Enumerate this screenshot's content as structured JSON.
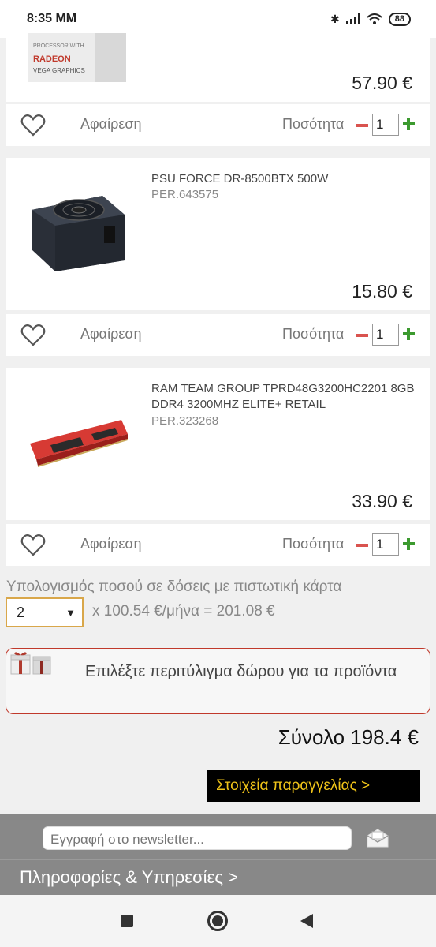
{
  "status_bar": {
    "time": "8:35 MM",
    "battery": "88"
  },
  "cart": {
    "items": [
      {
        "price": "57.90 €",
        "qty": "1"
      },
      {
        "name": "PSU FORCE DR-8500BTX 500W",
        "code": "PER.643575",
        "price": "15.80 €",
        "qty": "1"
      },
      {
        "name": "RAM TEAM GROUP TPRD48G3200HC2201 8GB DDR4 3200MHZ ELITE+ RETAIL",
        "code": "PER.323268",
        "price": "33.90 €",
        "qty": "1"
      }
    ],
    "item_image_text": [
      "PROCESSOR WITH",
      "RADEON",
      "VEGA GRAPHICS"
    ],
    "remove_label": "Αφαίρεση",
    "qty_label": "Ποσότητα"
  },
  "installments": {
    "label": "Υπολογισμός ποσού σε δόσεις με πιστωτική κάρτα",
    "selected": "2",
    "calc": "x 100.54 €/μήνα = 201.08 €"
  },
  "gift": {
    "label": "Επιλέξτε περιτύλιγμα δώρου για τα προϊόντα"
  },
  "total": {
    "label": "Σύνολο 198.4 €"
  },
  "order_button": {
    "label": "Στοιχεία παραγγελίας >"
  },
  "footer": {
    "newsletter_placeholder": "Εγγραφή στο newsletter...",
    "info_label": "Πληροφορίες & Υπηρεσίες >"
  },
  "colors": {
    "remove_red": "#d9534f",
    "add_green": "#3c9a2f",
    "order_text": "#f0c419",
    "gift_border": "#c0392b"
  }
}
